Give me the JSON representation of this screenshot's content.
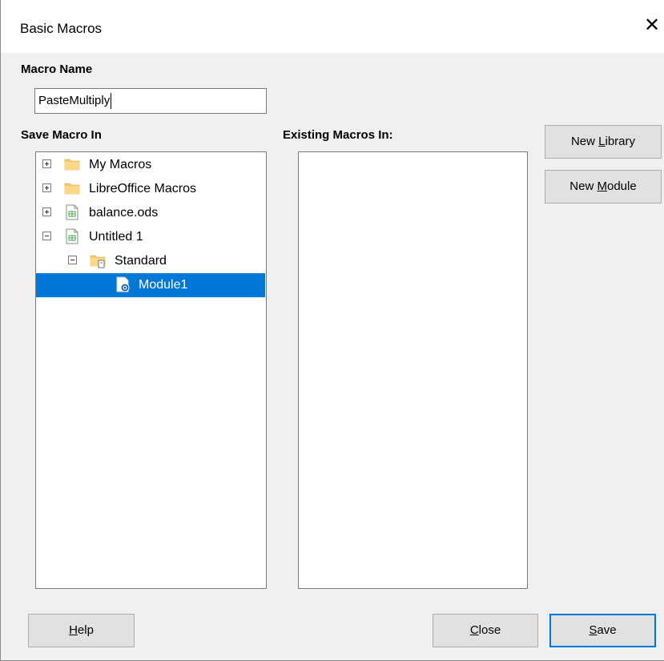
{
  "window": {
    "title": "Basic Macros",
    "close_glyph": "✕"
  },
  "macro_name": {
    "label": "Macro Name",
    "value": "PasteMultiply"
  },
  "save_in": {
    "label": "Save Macro In",
    "tree": [
      {
        "label": "My Macros",
        "expander": "plus",
        "icon": "folder-icon",
        "level": 0,
        "selected": false
      },
      {
        "label": "LibreOffice Macros",
        "expander": "plus",
        "icon": "folder-icon",
        "level": 0,
        "selected": false
      },
      {
        "label": "balance.ods",
        "expander": "plus",
        "icon": "spreadsheet-icon",
        "level": 0,
        "selected": false
      },
      {
        "label": "Untitled 1",
        "expander": "minus",
        "icon": "spreadsheet-icon",
        "level": 0,
        "selected": false
      },
      {
        "label": "Standard",
        "expander": "minus",
        "icon": "library-folder-icon",
        "level": 1,
        "selected": false
      },
      {
        "label": "Module1",
        "expander": "none",
        "icon": "basic-module-icon",
        "level": 2,
        "selected": true
      }
    ]
  },
  "existing": {
    "label": "Existing Macros In:",
    "items": []
  },
  "buttons": {
    "new_library": {
      "pre": "New ",
      "mnemonic": "L",
      "post": "ibrary"
    },
    "new_module": {
      "pre": "New ",
      "mnemonic": "M",
      "post": "odule"
    },
    "help": {
      "pre": "",
      "mnemonic": "H",
      "post": "elp"
    },
    "close": {
      "pre": "",
      "mnemonic": "C",
      "post": "lose"
    },
    "save": {
      "pre": "",
      "mnemonic": "S",
      "post": "ave"
    }
  },
  "colors": {
    "selection": "#0078d7",
    "default_button_border": "#0078d7",
    "folder": "#f8c86a",
    "background": "#f0f0f0"
  }
}
